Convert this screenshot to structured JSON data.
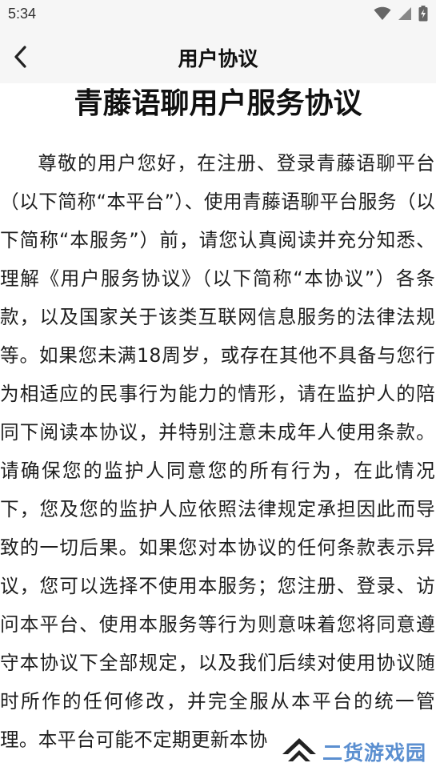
{
  "status_bar": {
    "time": "5:34"
  },
  "nav": {
    "title": "用户协议",
    "back_icon": "chevron-left-icon"
  },
  "document": {
    "title": "青藤语聊用户服务协议",
    "body": "尊敬的用户您好，在注册、登录青藤语聊平台（以下简称“本平台”）、使用青藤语聊平台服务（以下简称“本服务”）前，请您认真阅读并充分知悉、理解《用户服务协议》（以下简称“本协议”）各条款，以及国家关于该类互联网信息服务的法律法规等。如果您未满18周岁，或存在其他不具备与您行为相适应的民事行为能力的情形，请在监护人的陪同下阅读本协议，并特别注意未成年人使用条款。请确保您的监护人同意您的所有行为，在此情况下，您及您的监护人应依照法律规定承担因此而导致的一切后果。如果您对本协议的任何条款表示异议，您可以选择不使用本服务；您注册、登录、访问本平台、使用本服务等行为则意味着您将同意遵守本协议下全部规定，以及我们后续对使用协议随时所作的任何修改，并完全服从本平台的统一管理。本平台可能不定期更新本协"
  },
  "watermark": {
    "text": "二货游戏园",
    "color": "#5b8fd0"
  },
  "colors": {
    "bar_background": "#f6f6f6",
    "page_background": "#ffffff",
    "text": "#1e1e1e"
  }
}
